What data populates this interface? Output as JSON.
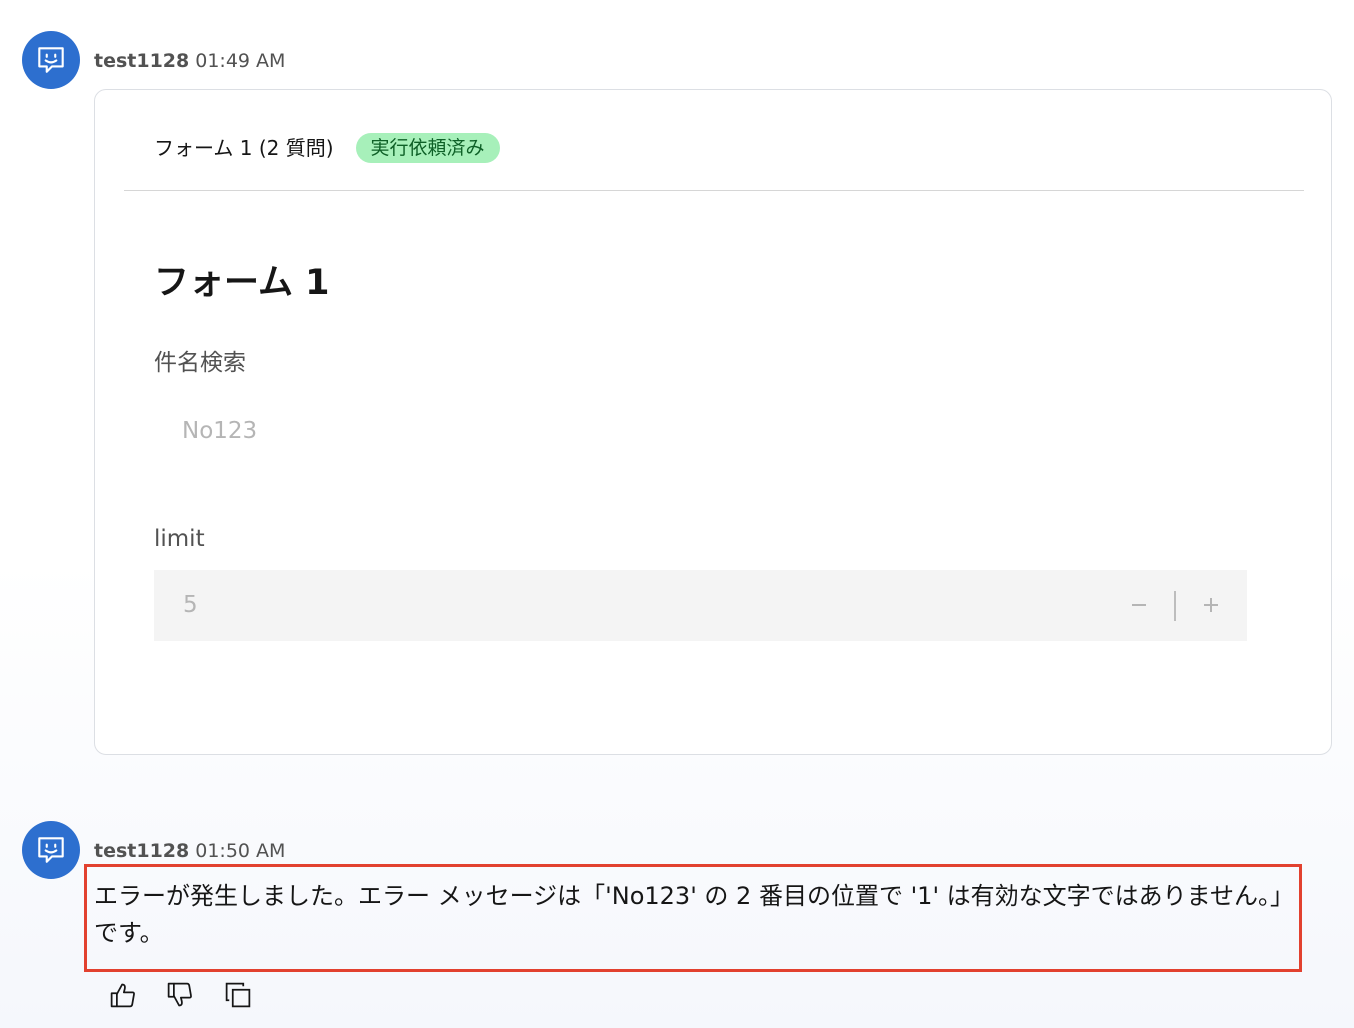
{
  "messages": [
    {
      "author": "test1128",
      "time": "01:49 AM",
      "avatar_icon": "chat-bot-icon"
    },
    {
      "author": "test1128",
      "time": "01:50 AM",
      "avatar_icon": "chat-bot-icon",
      "text": "エラーが発生しました。エラー メッセージは「'No123' の 2 番目の位置で '1' は有効な文字ではありません。」です。"
    }
  ],
  "form_card": {
    "header_title": "フォーム 1 (2 質問)",
    "status": "実行依頼済み",
    "form_title": "フォーム 1",
    "fields": [
      {
        "label": "件名検索",
        "value": "No123"
      },
      {
        "label": "limit",
        "value": "5",
        "decrement_icon": "minus-icon",
        "increment_icon": "plus-icon"
      }
    ]
  },
  "actions": [
    {
      "icon": "thumbs-up-icon"
    },
    {
      "icon": "thumbs-down-icon"
    },
    {
      "icon": "copy-icon"
    }
  ],
  "colors": {
    "avatar": "#2d6fcf",
    "status_tag_bg": "#a7f0ba",
    "status_tag_text": "#0e6027",
    "highlight_border": "#e2412f"
  }
}
